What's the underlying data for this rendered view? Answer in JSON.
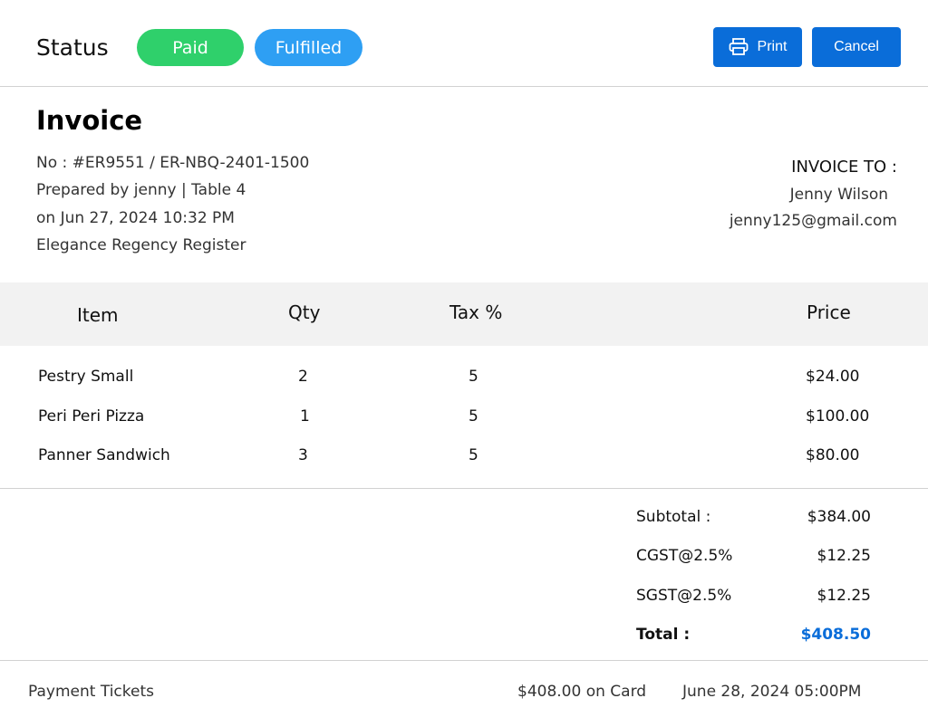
{
  "header": {
    "status_label": "Status",
    "badges": {
      "paid": "Paid",
      "fulfilled": "Fulfilled"
    },
    "print_label": "Print",
    "print_icon": "printer-icon",
    "cancel_label": "Cancel"
  },
  "invoice": {
    "title": "Invoice",
    "number": "No : #ER9551 / ER-NBQ-2401-1500",
    "prepared": "Prepared by jenny | Table 4",
    "date": "on Jun 27, 2024 10:32 PM",
    "register": "Elegance Regency Register",
    "bill_to": {
      "label": "INVOICE TO :",
      "name": "Jenny Wilson",
      "email": "jenny125@gmail.com"
    }
  },
  "table": {
    "headers": {
      "item": "Item",
      "qty": "Qty",
      "tax": "Tax %",
      "price": "Price"
    },
    "rows": [
      {
        "item": "Pestry Small",
        "qty": "2",
        "tax": "5",
        "price": "$24.00"
      },
      {
        "item": "Peri Peri Pizza",
        "qty": "1",
        "tax": "5",
        "price": "$100.00"
      },
      {
        "item": "Panner Sandwich",
        "qty": "3",
        "tax": "5",
        "price": "$80.00"
      }
    ]
  },
  "totals": {
    "subtotal_label": "Subtotal :",
    "subtotal": "$384.00",
    "cgst_label": "CGST@2.5%",
    "cgst": "$12.25",
    "sgst_label": "SGST@2.5%",
    "sgst": "$12.25",
    "total_label": "Total :",
    "total": "$408.50"
  },
  "payment": {
    "label": "Payment Tickets",
    "amount": "$408.00 on Card",
    "date": "June 28, 2024 05:00PM"
  },
  "colors": {
    "paid_badge": "#2fd06b",
    "fulfilled_badge": "#2e9ff3",
    "primary_button": "#0a6dd9",
    "total_value": "#0a6dd9",
    "table_header_bg": "#f2f2f2"
  }
}
